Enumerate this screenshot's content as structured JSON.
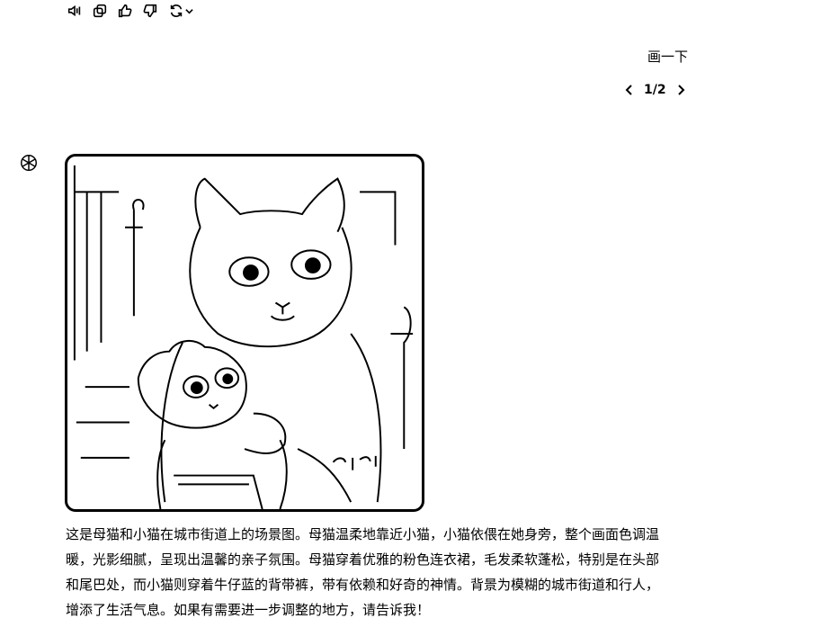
{
  "toolbar": {
    "icons": [
      "speaker-icon",
      "copy-icon",
      "thumbs-up-icon",
      "thumbs-down-icon",
      "regenerate-icon",
      "chevron-down-icon"
    ]
  },
  "user_message": {
    "text": "画一下"
  },
  "pager": {
    "label": "1/2"
  },
  "assistant": {
    "avatar_icon": "openai-logo-icon",
    "image_icon": "generated-image",
    "answer_lines": [
      "这是母猫和小猫在城市街道上的场景图。母猫温柔地靠近小猫，小猫依偎在她身旁，整个画面色调温",
      "暖，光影细腻，呈现出温馨的亲子氛围。母猫穿着优雅的粉色连衣裙，毛发柔软蓬松，特别是在头部",
      "和尾巴处，而小猫则穿着牛仔蓝的背带裤，带有依赖和好奇的神情。背景为模糊的城市街道和行人，",
      "增添了生活气息。如果有需要进一步调整的地方，请告诉我！"
    ]
  }
}
